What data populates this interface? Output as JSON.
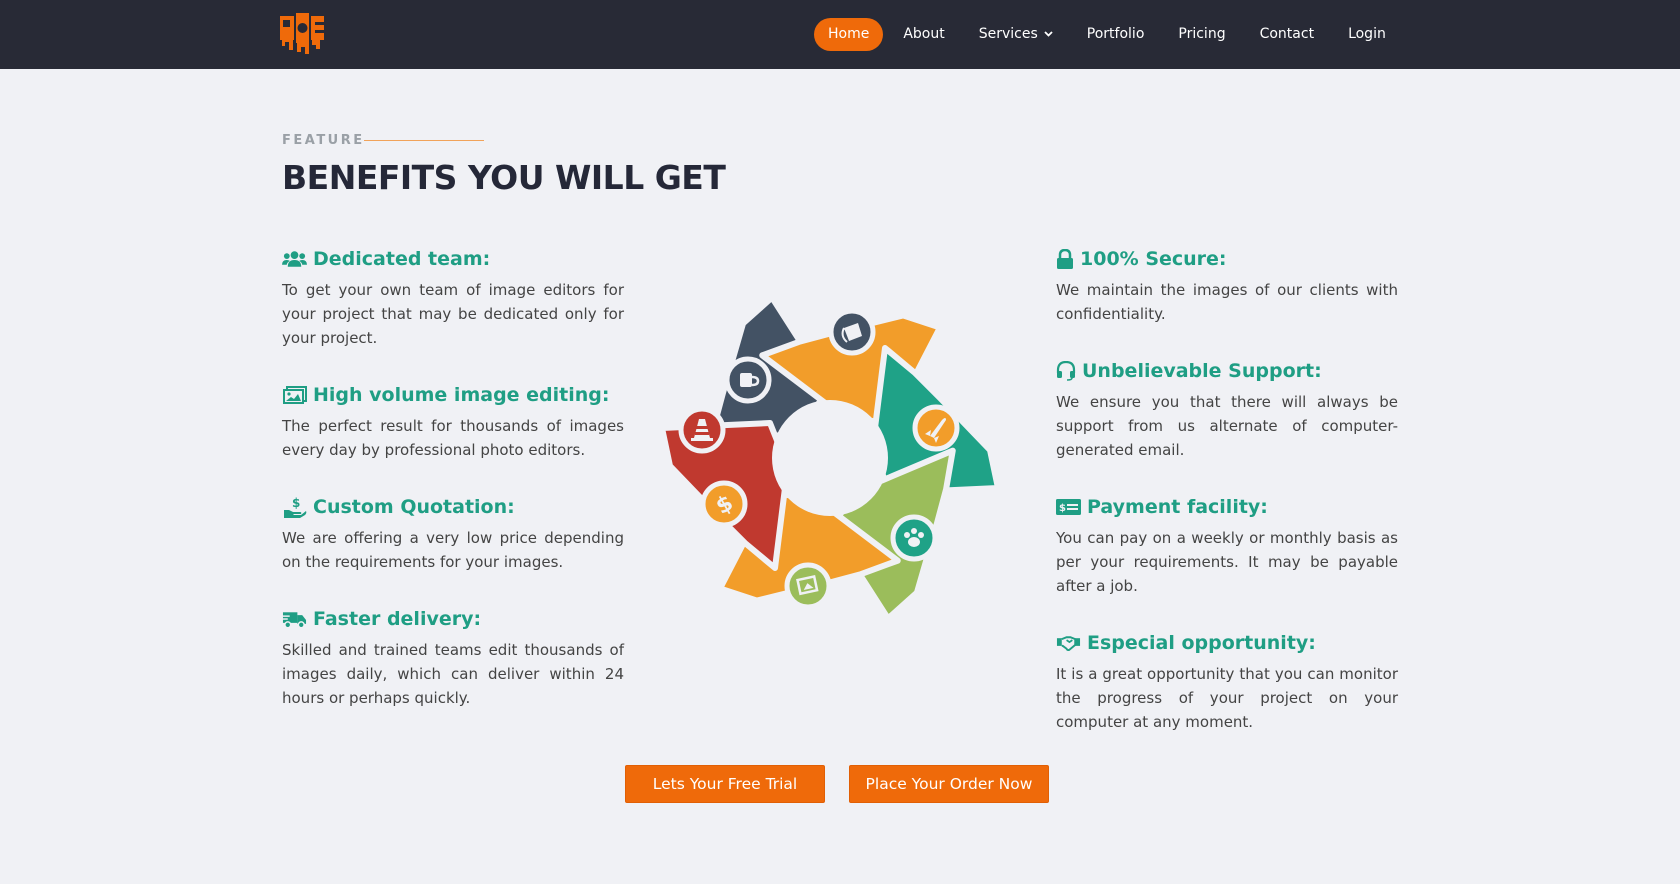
{
  "nav": {
    "items": [
      {
        "label": "Home",
        "active": true
      },
      {
        "label": "About"
      },
      {
        "label": "Services"
      },
      {
        "label": "Portfolio"
      },
      {
        "label": "Pricing"
      },
      {
        "label": "Contact"
      },
      {
        "label": "Login"
      }
    ]
  },
  "section": {
    "eyebrow": "FEATURE",
    "title": "BENEFITS YOU WILL GET"
  },
  "features_left": [
    {
      "icon": "users-icon",
      "title": "Dedicated team:",
      "text": "To get your own team of image editors for your project that may be dedicated only for your project."
    },
    {
      "icon": "image-icon",
      "title": "High volume image editing:",
      "text": "The perfect result for thousands of images every day by professional photo editors."
    },
    {
      "icon": "hand-dollar-icon",
      "title": "Custom Quotation:",
      "text": "We are offering a very low price depending on the requirements for your images."
    },
    {
      "icon": "truck-icon",
      "title": "Faster delivery:",
      "text": "Skilled and trained teams edit thousands of images daily, which can deliver within 24 hours or perhaps quickly."
    }
  ],
  "features_right": [
    {
      "icon": "lock-icon",
      "title": "100% Secure:",
      "text": "We maintain the images of our clients with confidentiality."
    },
    {
      "icon": "headset-icon",
      "title": "Unbelievable Support:",
      "text": "We ensure you that there will always be support from us alternate of computer-generated email."
    },
    {
      "icon": "money-bill-icon",
      "title": "Payment facility:",
      "text": "You can pay on a weekly or monthly basis as per your requirements. It may be payable after a job."
    },
    {
      "icon": "handshake-icon",
      "title": "Especial opportunity:",
      "text": "It is a great opportunity that you can monitor the progress of your project on your computer at any moment."
    }
  ],
  "buttons": {
    "trial": "Lets Your Free Trial",
    "order": "Place Your Order Now"
  },
  "colors": {
    "accent": "#ef6a0a",
    "nav_bg": "#282a36",
    "feature_title": "#1f9e84",
    "wheel": [
      "#435264",
      "#f29d2a",
      "#1fa287",
      "#9bbd5b",
      "#f29d2a",
      "#c0392f"
    ]
  }
}
